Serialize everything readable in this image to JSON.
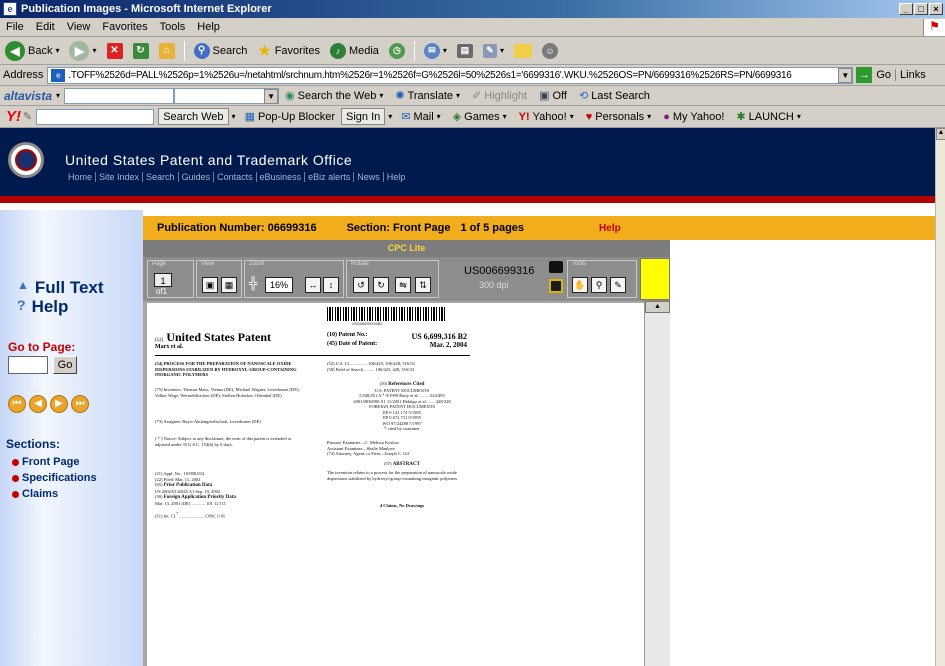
{
  "window": {
    "title": "Publication Images - Microsoft Internet Explorer"
  },
  "menu": [
    "File",
    "Edit",
    "View",
    "Favorites",
    "Tools",
    "Help"
  ],
  "toolbar": {
    "back_label": "Back",
    "search_label": "Search",
    "favorites_label": "Favorites",
    "media_label": "Media"
  },
  "address": {
    "label": "Address",
    "url": ".TOFF%2526d=PALL%2526p=1%2526u=/netahtml/srchnum.htm%2526r=1%2526f=G%2526l=50%2526s1='6699316'.WKU.%2526OS=PN/6699316%2526RS=PN/6699316",
    "go_label": "Go",
    "links_label": "Links"
  },
  "altavista": {
    "brand": "altavista",
    "search_web": "Search the Web",
    "translate": "Translate",
    "highlight": "Highlight",
    "off": "Off",
    "last_search": "Last Search"
  },
  "yahoo": {
    "search_web": "Search Web",
    "popup_blocker": "Pop-Up Blocker",
    "sign_in": "Sign In",
    "mail": "Mail",
    "games": "Games",
    "yahoo_link": "Yahoo!",
    "personals": "Personals",
    "my_yahoo": "My Yahoo!",
    "launch": "LAUNCH"
  },
  "site": {
    "title": "United States Patent and Trademark Office",
    "nav": [
      "Home",
      "Site Index",
      "Search",
      "Guides",
      "Contacts",
      "eBusiness",
      "eBiz alerts",
      "News",
      "Help"
    ]
  },
  "left_nav": {
    "full_text": "Full Text",
    "help": "Help",
    "goto_label": "Go to Page:",
    "go_button": "Go",
    "sections_label": "Sections:",
    "sections": [
      "Front Page",
      "Specifications",
      "Claims"
    ]
  },
  "publication": {
    "number_label": "Publication Number: 06699316",
    "section_label": "Section: Front Page",
    "pages_label": "1 of 5 pages",
    "help_label": "Help"
  },
  "viewer": {
    "cpc_label": "CPC Lite",
    "page_value": "1",
    "page_of": "of1",
    "zoom": "16%",
    "doc_id": "US006699316",
    "dpi": "300 dpi"
  },
  "document": {
    "heading_prefix": "(12)",
    "heading": "United States Patent",
    "authors": "Marx et al.",
    "patent_no_label": "(10) Patent No.:",
    "patent_no": "US 6,699,316 B2",
    "date_label": "(45) Date of Patent:",
    "date": "Mar. 2, 2004",
    "title_block": "(54) PROCESS FOR THE PREPARATION OF NANOSCALE OXIDE DISPERSIONS STABILIZED BY HYDROXYL-GROUP-CONTAINING INORGANIC POLYMERS",
    "abstract_label": "ABSTRACT",
    "references_label": "References Cited",
    "us_docs_label": "U.S. PATENT DOCUMENTS",
    "foreign_label": "FOREIGN PATENT DOCUMENTS",
    "claims_label": "4 Claims, No Drawings",
    "priority_label": "Prior Publication Data",
    "foreign_app_label": "Foreign Application Priority Data"
  }
}
